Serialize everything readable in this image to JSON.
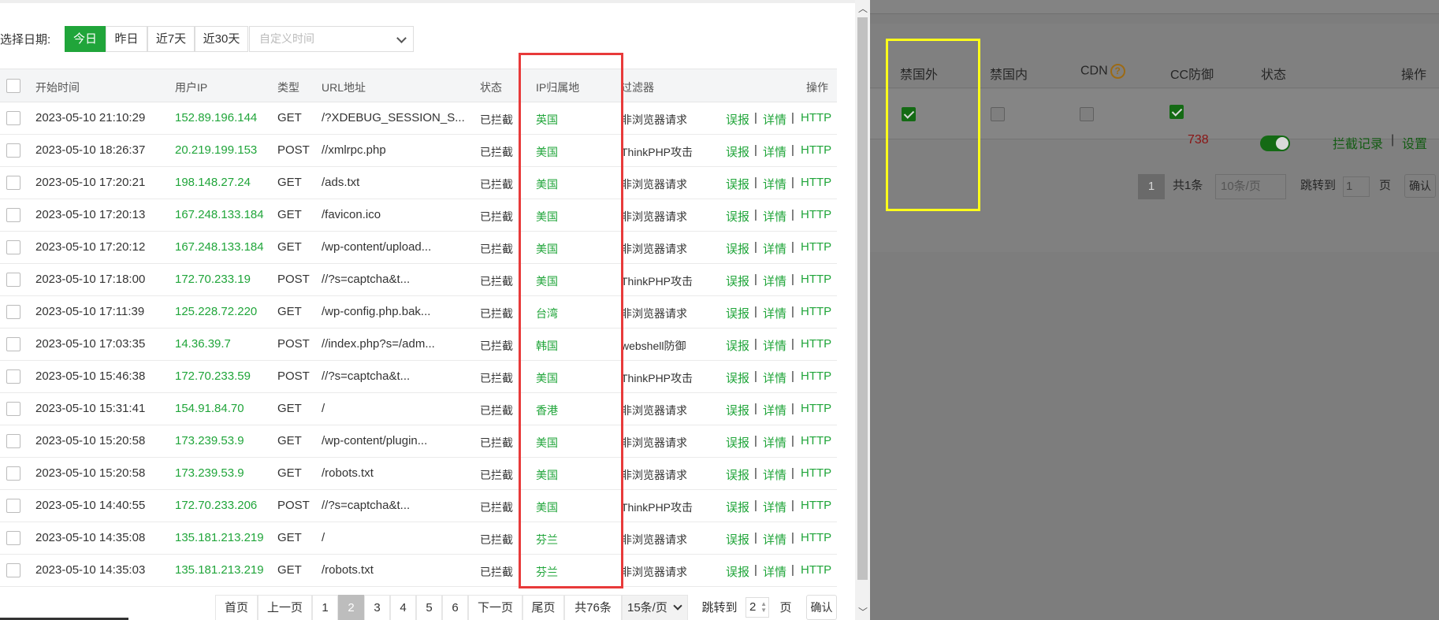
{
  "date_filter": {
    "label": "选择日期:",
    "buttons": [
      "今日",
      "昨日",
      "近7天",
      "近30天"
    ],
    "active": "今日",
    "custom_placeholder": "自定义时间"
  },
  "table": {
    "headers": {
      "start_time": "开始时间",
      "user_ip": "用户IP",
      "type": "类型",
      "url": "URL地址",
      "status": "状态",
      "ip_region": "IP归属地",
      "filter": "过滤器",
      "actions": "操作"
    },
    "action_labels": {
      "report": "误报",
      "details": "详情",
      "http": "HTTP",
      "sep": "|"
    },
    "rows": [
      {
        "time": "2023-05-10 21:10:29",
        "ip": "152.89.196.144",
        "type": "GET",
        "url": "/?XDEBUG_SESSION_S...",
        "status": "已拦截",
        "region": "英国",
        "filter": "非浏览器请求"
      },
      {
        "time": "2023-05-10 18:26:37",
        "ip": "20.219.199.153",
        "type": "POST",
        "url": "//xmlrpc.php",
        "status": "已拦截",
        "region": "美国",
        "filter": "ThinkPHP攻击"
      },
      {
        "time": "2023-05-10 17:20:21",
        "ip": "198.148.27.24",
        "type": "GET",
        "url": "/ads.txt",
        "status": "已拦截",
        "region": "美国",
        "filter": "非浏览器请求"
      },
      {
        "time": "2023-05-10 17:20:13",
        "ip": "167.248.133.184",
        "type": "GET",
        "url": "/favicon.ico",
        "status": "已拦截",
        "region": "美国",
        "filter": "非浏览器请求"
      },
      {
        "time": "2023-05-10 17:20:12",
        "ip": "167.248.133.184",
        "type": "GET",
        "url": "/wp-content/upload...",
        "status": "已拦截",
        "region": "美国",
        "filter": "非浏览器请求"
      },
      {
        "time": "2023-05-10 17:18:00",
        "ip": "172.70.233.19",
        "type": "POST",
        "url": "//?s=captcha&t...",
        "status": "已拦截",
        "region": "美国",
        "filter": "ThinkPHP攻击"
      },
      {
        "time": "2023-05-10 17:11:39",
        "ip": "125.228.72.220",
        "type": "GET",
        "url": "/wp-config.php.bak...",
        "status": "已拦截",
        "region": "台湾",
        "filter": "非浏览器请求"
      },
      {
        "time": "2023-05-10 17:03:35",
        "ip": "14.36.39.7",
        "type": "POST",
        "url": "//index.php?s=/adm...",
        "status": "已拦截",
        "region": "韩国",
        "filter": "webshell防御"
      },
      {
        "time": "2023-05-10 15:46:38",
        "ip": "172.70.233.59",
        "type": "POST",
        "url": "//?s=captcha&t...",
        "status": "已拦截",
        "region": "美国",
        "filter": "ThinkPHP攻击"
      },
      {
        "time": "2023-05-10 15:31:41",
        "ip": "154.91.84.70",
        "type": "GET",
        "url": "/",
        "status": "已拦截",
        "region": "香港",
        "filter": "非浏览器请求"
      },
      {
        "time": "2023-05-10 15:20:58",
        "ip": "173.239.53.9",
        "type": "GET",
        "url": "/wp-content/plugin...",
        "status": "已拦截",
        "region": "美国",
        "filter": "非浏览器请求"
      },
      {
        "time": "2023-05-10 15:20:58",
        "ip": "173.239.53.9",
        "type": "GET",
        "url": "/robots.txt",
        "status": "已拦截",
        "region": "美国",
        "filter": "非浏览器请求"
      },
      {
        "time": "2023-05-10 14:40:55",
        "ip": "172.70.233.206",
        "type": "POST",
        "url": "//?s=captcha&t...",
        "status": "已拦截",
        "region": "美国",
        "filter": "ThinkPHP攻击"
      },
      {
        "time": "2023-05-10 14:35:08",
        "ip": "135.181.213.219",
        "type": "GET",
        "url": "/",
        "status": "已拦截",
        "region": "芬兰",
        "filter": "非浏览器请求"
      },
      {
        "time": "2023-05-10 14:35:03",
        "ip": "135.181.213.219",
        "type": "GET",
        "url": "/robots.txt",
        "status": "已拦截",
        "region": "芬兰",
        "filter": "非浏览器请求"
      }
    ]
  },
  "pagination": {
    "first": "首页",
    "prev": "上一页",
    "pages": [
      "1",
      "2",
      "3",
      "4",
      "5",
      "6"
    ],
    "current": "2",
    "next": "下一页",
    "last": "尾页",
    "total": "共76条",
    "per_page": "15条/页",
    "jump_label": "跳转到",
    "jump_value": "2",
    "page_suffix": "页",
    "confirm": "确认"
  },
  "background": {
    "headers": {
      "ban_foreign": "禁国外",
      "ban_domestic": "禁国内",
      "cdn": "CDN",
      "cc": "CC防御",
      "status": "状态",
      "actions": "操作"
    },
    "cdn_help": "?",
    "row": {
      "ban_foreign": true,
      "ban_domestic": false,
      "cdn": false,
      "cc_enabled": true,
      "cc_count": "738",
      "status_on": true,
      "link_records": "拦截记录",
      "sep": "|",
      "link_settings": "设置"
    },
    "pager": {
      "page": "1",
      "total": "共1条",
      "per_page": "10条/页",
      "jump_label": "跳转到",
      "jump_value": "1",
      "page_suffix": "页",
      "confirm": "确认"
    }
  },
  "colors": {
    "accent": "#20a53a",
    "highlight_red": "#e83a3a",
    "highlight_yellow": "#ffff1a"
  }
}
